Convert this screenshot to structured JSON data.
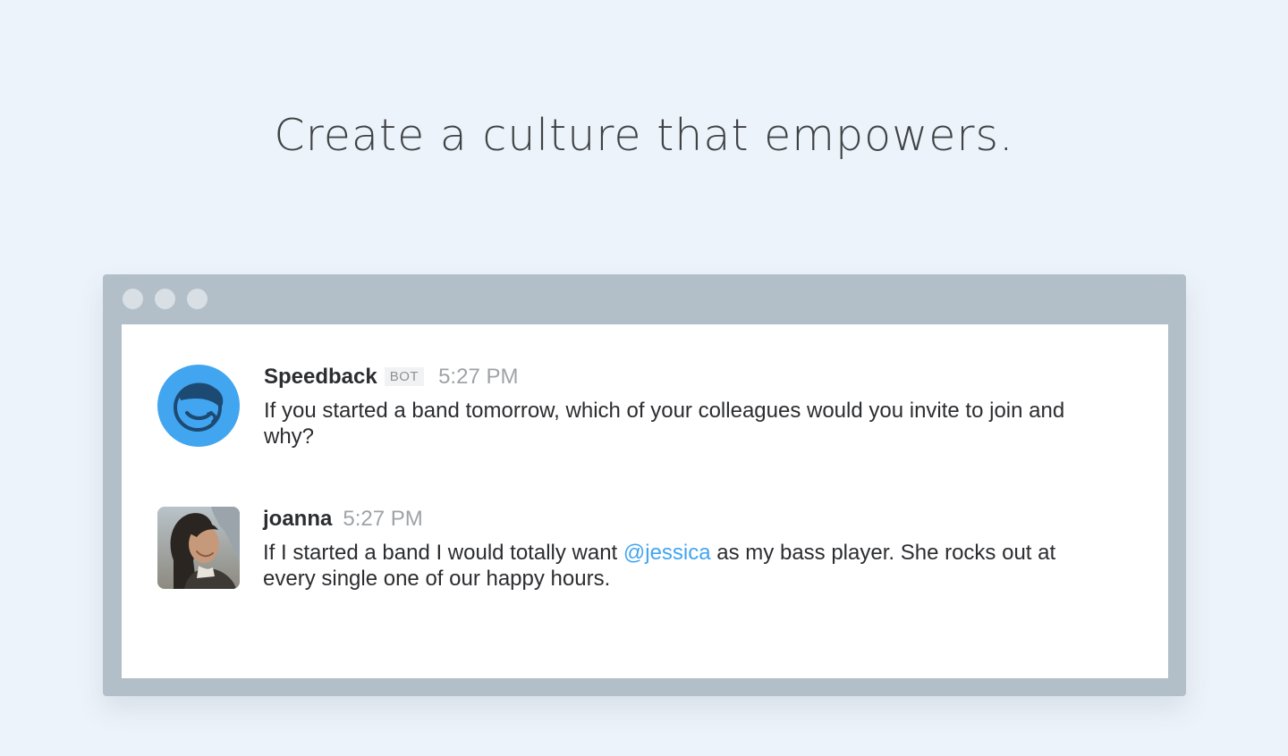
{
  "page": {
    "headline": "Create a culture that empowers."
  },
  "colors": {
    "background": "#edf3fa",
    "window_frame": "#b2bfc9",
    "bot_avatar": "#42a5f0",
    "mention": "#42a5f0"
  },
  "chat": {
    "messages": [
      {
        "sender": "Speedback",
        "badge": "BOT",
        "time": "5:27 PM",
        "avatar_icon": "speedback-face-icon",
        "text": "If you started a band tomorrow, which of your colleagues would you invite to join and why?"
      },
      {
        "sender": "joanna",
        "time": "5:27 PM",
        "avatar_icon": "user-photo",
        "text_before": "If I started a band I would totally want ",
        "mention": "@jessica",
        "text_after": " as my bass player. She rocks out at every single one of our happy hours."
      }
    ]
  }
}
